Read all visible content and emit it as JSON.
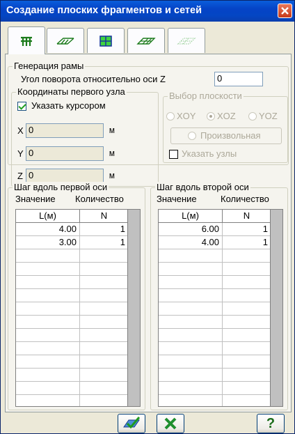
{
  "window": {
    "title": "Создание плоских фрагментов и сетей",
    "close_label": "x"
  },
  "tabs": [
    {
      "icon": "frame-grid-icon",
      "active": true
    },
    {
      "icon": "hatched-frame-icon",
      "active": false
    },
    {
      "icon": "green-grid-icon",
      "active": false
    },
    {
      "icon": "plate-mesh-icon",
      "active": false
    },
    {
      "icon": "dotted-mesh-icon",
      "active": false
    }
  ],
  "frame_generation": {
    "legend": "Генерация рамы",
    "rotation_label": "Угол поворота относительно оси Z",
    "rotation_value": "0"
  },
  "first_node": {
    "legend": "Координаты первого узла",
    "cursor_label": "Указать курсором",
    "cursor_checked": true,
    "x_label": "X",
    "x_value": "0",
    "y_label": "Y",
    "y_value": "0",
    "z_label": "Z",
    "z_value": "0",
    "unit": "м"
  },
  "plane_select": {
    "legend": "Выбор плоскости",
    "options": [
      "XOY",
      "XOZ",
      "YOZ"
    ],
    "selected": "XOZ",
    "arbitrary_label": "Произвольная",
    "specify_nodes_label": "Указать узлы"
  },
  "axis1": {
    "legend": "Шаг вдоль первой оси",
    "value_header": "Значение",
    "count_header": "Количество",
    "col_l": "L(м)",
    "col_n": "N",
    "rows": [
      {
        "l": "4.00",
        "n": "1"
      },
      {
        "l": "3.00",
        "n": "1"
      }
    ]
  },
  "axis2": {
    "legend": "Шаг вдоль второй оси",
    "value_header": "Значение",
    "count_header": "Количество",
    "col_l": "L(м)",
    "col_n": "N",
    "rows": [
      {
        "l": "6.00",
        "n": "1"
      },
      {
        "l": "4.00",
        "n": "1"
      }
    ]
  },
  "buttons": {
    "apply_icon": "apply-check-icon",
    "cancel_icon": "cancel-x-icon",
    "help_label": "?"
  },
  "colors": {
    "title_bar": "#0543c6",
    "close": "#c73a1a",
    "accent_green": "#21a121",
    "help_question": "#1a6b1a"
  }
}
